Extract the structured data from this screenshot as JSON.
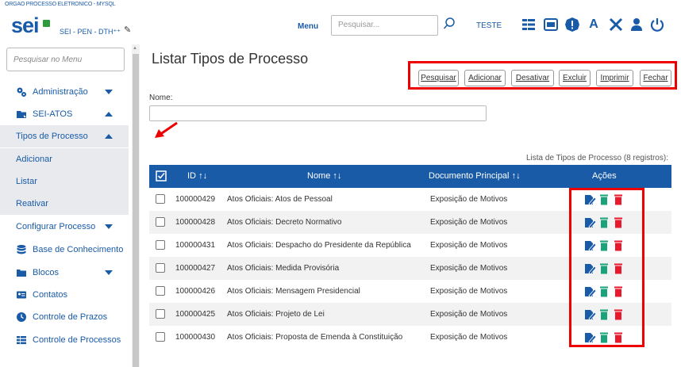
{
  "header": {
    "org": "ORGAO PROCESSO ELETRONICO - MYSQL",
    "logo": "sei",
    "system": "SEI - PEN - DTH⁺⁺",
    "menu_label": "Menu",
    "search_placeholder": "Pesquisar...",
    "unit": "TESTE"
  },
  "sidebar": {
    "search_placeholder": "Pesquisar no Menu",
    "items": [
      {
        "label": "Administração",
        "icon": "gears-icon"
      },
      {
        "label": "SEI-ATOS",
        "icon": "folder-icon"
      },
      {
        "label": "Tipos de Processo"
      },
      {
        "label": "Adicionar"
      },
      {
        "label": "Listar"
      },
      {
        "label": "Reativar"
      },
      {
        "label": "Configurar Processo"
      },
      {
        "label": "Base de Conhecimento",
        "icon": "database-icon"
      },
      {
        "label": "Blocos",
        "icon": "folders-icon"
      },
      {
        "label": "Contatos",
        "icon": "contact-card-icon"
      },
      {
        "label": "Controle de Prazos",
        "icon": "clock-icon"
      },
      {
        "label": "Controle de Processos",
        "icon": "list-icon"
      }
    ]
  },
  "page": {
    "title": "Listar Tipos de Processo",
    "buttons": {
      "pesquisar": "Pesquisar",
      "adicionar": "Adicionar",
      "desativar": "Desativar",
      "excluir": "Excluir",
      "imprimir": "Imprimir",
      "fechar": "Fechar"
    },
    "field_label": "Nome:",
    "caption": "Lista de Tipos de Processo (8 registros):"
  },
  "table": {
    "headers": {
      "id": "ID",
      "nome": "Nome",
      "doc": "Documento Principal",
      "acoes": "Ações"
    },
    "rows": [
      {
        "id": "100000429",
        "nome": "Atos Oficiais: Atos de Pessoal",
        "doc": "Exposição de Motivos"
      },
      {
        "id": "100000428",
        "nome": "Atos Oficiais: Decreto Normativo",
        "doc": "Exposição de Motivos"
      },
      {
        "id": "100000431",
        "nome": "Atos Oficiais: Despacho do Presidente da República",
        "doc": "Exposição de Motivos"
      },
      {
        "id": "100000427",
        "nome": "Atos Oficiais: Medida Provisória",
        "doc": "Exposição de Motivos"
      },
      {
        "id": "100000426",
        "nome": "Atos Oficiais: Mensagem Presidencial",
        "doc": "Exposição de Motivos"
      },
      {
        "id": "100000425",
        "nome": "Atos Oficiais: Projeto de Lei",
        "doc": "Exposição de Motivos"
      },
      {
        "id": "100000430",
        "nome": "Atos Oficiais: Proposta de Emenda à Constituição",
        "doc": "Exposição de Motivos"
      }
    ]
  },
  "colors": {
    "brand": "#1a5ba8",
    "highlight": "#ee0000",
    "trash_green": "#1aa37a",
    "trash_red": "#e8192c"
  }
}
